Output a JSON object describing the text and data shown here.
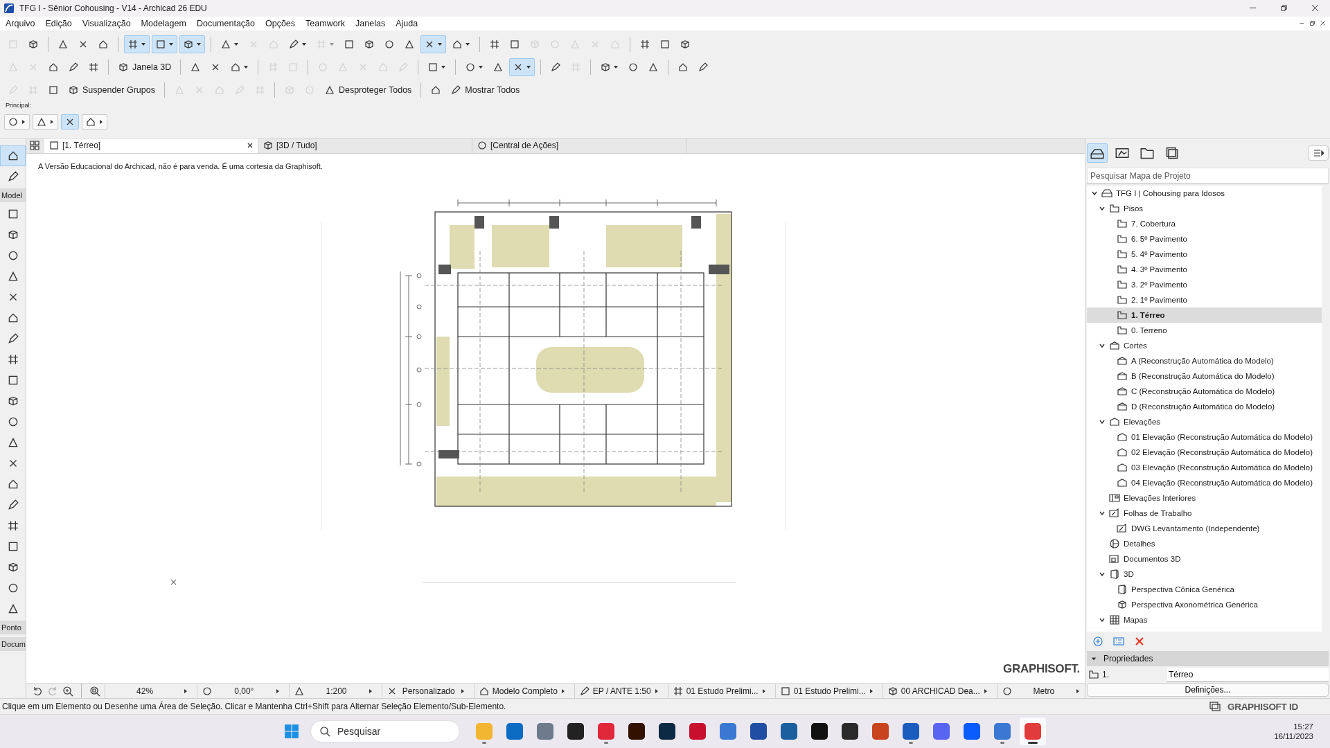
{
  "window": {
    "title": "TFG I - Sênior Cohousing - V14 - Archicad 26 EDU"
  },
  "menu": [
    "Arquivo",
    "Edição",
    "Visualização",
    "Modelagem",
    "Documentação",
    "Opções",
    "Teamwork",
    "Janelas",
    "Ajuda"
  ],
  "toolbars": [
    {
      "items": [
        {
          "kind": "icon",
          "dropdown": false,
          "pressed": false,
          "disabled": true
        },
        {
          "kind": "icon",
          "dropdown": false,
          "pressed": false,
          "disabled": false
        },
        {
          "kind": "separator"
        },
        {
          "kind": "icon",
          "dropdown": false,
          "pressed": false,
          "disabled": false
        },
        {
          "kind": "icon",
          "dropdown": false,
          "pressed": false,
          "disabled": false
        },
        {
          "kind": "icon",
          "dropdown": false,
          "pressed": false,
          "disabled": false
        },
        {
          "kind": "separator"
        },
        {
          "kind": "icon",
          "dropdown": true,
          "pressed": true,
          "disabled": false
        },
        {
          "kind": "icon",
          "dropdown": true,
          "pressed": true,
          "disabled": false
        },
        {
          "kind": "icon",
          "dropdown": true,
          "pressed": true,
          "disabled": false
        },
        {
          "kind": "separator"
        },
        {
          "kind": "icon",
          "dropdown": true,
          "pressed": false,
          "disabled": false
        },
        {
          "kind": "icon",
          "dropdown": false,
          "pressed": false,
          "disabled": true
        },
        {
          "kind": "icon",
          "dropdown": false,
          "pressed": false,
          "disabled": true
        },
        {
          "kind": "icon",
          "dropdown": true,
          "pressed": false,
          "disabled": false
        },
        {
          "kind": "icon",
          "dropdown": true,
          "pressed": false,
          "disabled": true
        },
        {
          "kind": "icon",
          "dropdown": false,
          "pressed": false,
          "disabled": false
        },
        {
          "kind": "icon",
          "dropdown": false,
          "pressed": false,
          "disabled": false
        },
        {
          "kind": "icon",
          "dropdown": false,
          "pressed": false,
          "disabled": false
        },
        {
          "kind": "icon",
          "dropdown": false,
          "pressed": false,
          "disabled": false
        },
        {
          "kind": "icon",
          "dropdown": true,
          "pressed": true,
          "disabled": false
        },
        {
          "kind": "icon",
          "dropdown": true,
          "pressed": false,
          "disabled": false
        },
        {
          "kind": "separator"
        },
        {
          "kind": "icon",
          "dropdown": false,
          "pressed": false,
          "disabled": false
        },
        {
          "kind": "icon",
          "dropdown": false,
          "pressed": false,
          "disabled": false
        },
        {
          "kind": "icon",
          "dropdown": false,
          "pressed": false,
          "disabled": true
        },
        {
          "kind": "icon",
          "dropdown": false,
          "pressed": false,
          "disabled": true
        },
        {
          "kind": "icon",
          "dropdown": false,
          "pressed": false,
          "disabled": true
        },
        {
          "kind": "icon",
          "dropdown": false,
          "pressed": false,
          "disabled": true
        },
        {
          "kind": "icon",
          "dropdown": false,
          "pressed": false,
          "disabled": true
        },
        {
          "kind": "separator"
        },
        {
          "kind": "icon",
          "dropdown": false,
          "pressed": false,
          "disabled": false
        },
        {
          "kind": "icon",
          "dropdown": false,
          "pressed": false,
          "disabled": false
        },
        {
          "kind": "icon",
          "dropdown": false,
          "pressed": false,
          "disabled": false
        }
      ]
    },
    {
      "items": [
        {
          "kind": "icon",
          "dropdown": false,
          "pressed": false,
          "disabled": true
        },
        {
          "kind": "icon",
          "dropdown": false,
          "pressed": false,
          "disabled": true
        },
        {
          "kind": "icon",
          "dropdown": false,
          "pressed": false,
          "disabled": false
        },
        {
          "kind": "icon",
          "dropdown": false,
          "pressed": false,
          "disabled": false
        },
        {
          "kind": "icon",
          "dropdown": false,
          "pressed": false,
          "disabled": false
        },
        {
          "kind": "separator"
        },
        {
          "kind": "label",
          "label": "Janela 3D",
          "disabled": false
        },
        {
          "kind": "separator"
        },
        {
          "kind": "icon",
          "dropdown": false,
          "pressed": false,
          "disabled": false
        },
        {
          "kind": "icon",
          "dropdown": false,
          "pressed": false,
          "disabled": false
        },
        {
          "kind": "icon",
          "dropdown": true,
          "pressed": false,
          "disabled": false
        },
        {
          "kind": "separator"
        },
        {
          "kind": "icon",
          "dropdown": false,
          "pressed": false,
          "disabled": true
        },
        {
          "kind": "icon",
          "dropdown": false,
          "pressed": false,
          "disabled": true
        },
        {
          "kind": "separator"
        },
        {
          "kind": "icon",
          "dropdown": false,
          "pressed": false,
          "disabled": true
        },
        {
          "kind": "icon",
          "dropdown": false,
          "pressed": false,
          "disabled": true
        },
        {
          "kind": "icon",
          "dropdown": false,
          "pressed": false,
          "disabled": true
        },
        {
          "kind": "icon",
          "dropdown": false,
          "pressed": false,
          "disabled": true
        },
        {
          "kind": "icon",
          "dropdown": false,
          "pressed": false,
          "disabled": true
        },
        {
          "kind": "separator"
        },
        {
          "kind": "icon",
          "dropdown": true,
          "pressed": false,
          "disabled": false
        },
        {
          "kind": "separator"
        },
        {
          "kind": "icon",
          "dropdown": true,
          "pressed": false,
          "disabled": false
        },
        {
          "kind": "icon",
          "dropdown": false,
          "pressed": false,
          "disabled": false
        },
        {
          "kind": "icon",
          "dropdown": true,
          "pressed": true,
          "disabled": false
        },
        {
          "kind": "separator"
        },
        {
          "kind": "icon",
          "dropdown": false,
          "pressed": false,
          "disabled": false
        },
        {
          "kind": "icon",
          "dropdown": false,
          "pressed": false,
          "disabled": true
        },
        {
          "kind": "separator"
        },
        {
          "kind": "icon",
          "dropdown": true,
          "pressed": false,
          "disabled": false
        },
        {
          "kind": "icon",
          "dropdown": false,
          "pressed": false,
          "disabled": false
        },
        {
          "kind": "icon",
          "dropdown": false,
          "pressed": false,
          "disabled": false
        },
        {
          "kind": "separator"
        },
        {
          "kind": "icon",
          "dropdown": false,
          "pressed": false,
          "disabled": false
        },
        {
          "kind": "icon",
          "dropdown": false,
          "pressed": false,
          "disabled": false
        }
      ]
    },
    {
      "items": [
        {
          "kind": "icon",
          "dropdown": false,
          "pressed": false,
          "disabled": true
        },
        {
          "kind": "icon",
          "dropdown": false,
          "pressed": false,
          "disabled": true
        },
        {
          "kind": "icon",
          "dropdown": false,
          "pressed": false,
          "disabled": false
        },
        {
          "kind": "label",
          "label": "Suspender Grupos",
          "disabled": false
        },
        {
          "kind": "separator"
        },
        {
          "kind": "icon",
          "dropdown": false,
          "pressed": false,
          "disabled": true
        },
        {
          "kind": "icon",
          "dropdown": false,
          "pressed": false,
          "disabled": true
        },
        {
          "kind": "icon",
          "dropdown": false,
          "pressed": false,
          "disabled": true
        },
        {
          "kind": "icon",
          "dropdown": false,
          "pressed": false,
          "disabled": true
        },
        {
          "kind": "icon",
          "dropdown": false,
          "pressed": false,
          "disabled": true
        },
        {
          "kind": "separator"
        },
        {
          "kind": "icon",
          "dropdown": false,
          "pressed": false,
          "disabled": true
        },
        {
          "kind": "icon",
          "dropdown": false,
          "pressed": false,
          "disabled": true
        },
        {
          "kind": "label",
          "label": "Desproteger Todos",
          "disabled": false
        },
        {
          "kind": "separator"
        },
        {
          "kind": "icon",
          "dropdown": false,
          "pressed": false,
          "disabled": false
        },
        {
          "kind": "label",
          "label": "Mostrar Todos",
          "disabled": false
        }
      ]
    }
  ],
  "principal": {
    "label": "Principal:",
    "items": [
      {
        "dropdown": true,
        "pressed": false
      },
      {
        "dropdown": true,
        "pressed": false
      },
      {
        "dropdown": false,
        "pressed": true
      },
      {
        "dropdown": true,
        "pressed": false
      }
    ]
  },
  "toolbox": [
    {
      "kind": "tool",
      "selected": true
    },
    {
      "kind": "tool",
      "selected": false
    },
    {
      "kind": "header",
      "label": "Model"
    },
    {
      "kind": "tool",
      "selected": false
    },
    {
      "kind": "tool",
      "selected": false
    },
    {
      "kind": "tool",
      "selected": false
    },
    {
      "kind": "tool",
      "selected": false
    },
    {
      "kind": "tool",
      "selected": false
    },
    {
      "kind": "tool",
      "selected": false
    },
    {
      "kind": "tool",
      "selected": false
    },
    {
      "kind": "tool",
      "selected": false
    },
    {
      "kind": "tool",
      "selected": false
    },
    {
      "kind": "tool",
      "selected": false
    },
    {
      "kind": "tool",
      "selected": false
    },
    {
      "kind": "tool",
      "selected": false
    },
    {
      "kind": "tool",
      "selected": false
    },
    {
      "kind": "tool",
      "selected": false
    },
    {
      "kind": "tool",
      "selected": false
    },
    {
      "kind": "tool",
      "selected": false
    },
    {
      "kind": "tool",
      "selected": false
    },
    {
      "kind": "tool",
      "selected": false
    },
    {
      "kind": "tool",
      "selected": false
    },
    {
      "kind": "tool",
      "selected": false
    },
    {
      "kind": "header",
      "label": "Ponto"
    },
    {
      "kind": "header",
      "label": "Docum"
    }
  ],
  "tabs": [
    {
      "label": "[1. Térreo]",
      "selected": true,
      "closable": true
    },
    {
      "label": "[3D / Tudo]",
      "selected": false,
      "closable": false
    },
    {
      "label": "[Central de Ações]",
      "selected": false,
      "closable": false
    }
  ],
  "canvas": {
    "notice": "A Versão Educacional do Archicad, não é para venda. É uma cortesia da Graphisoft.",
    "logo": "GRAPHISOFT."
  },
  "status_bar": [
    {
      "text": "42%"
    },
    {
      "text": "0,00°"
    },
    {
      "text": "1:200"
    },
    {
      "text": "Personalizado"
    },
    {
      "text": "Modelo Completo"
    },
    {
      "text": "EP / ANTE 1:50"
    },
    {
      "text": "01 Estudo Prelimi..."
    },
    {
      "text": "01 Estudo Prelimi..."
    },
    {
      "text": "00 ARCHICAD Dea..."
    },
    {
      "text": "Metro"
    }
  ],
  "message": "Clique em um Elemento ou Desenhe uma Área de Seleção. Clicar e Mantenha Ctrl+Shift para Alternar Seleção Elemento/Sub-Elemento.",
  "project_map": {
    "tabs": [
      {
        "selected": true
      },
      {
        "selected": false
      },
      {
        "selected": false
      },
      {
        "selected": false
      }
    ],
    "search": {
      "placeholder": "Pesquisar Mapa de Projeto"
    },
    "tree": [
      {
        "label": "TFG I | Cohousing para Idosos",
        "kind": "project",
        "expanded": true,
        "selected": false,
        "children": [
          {
            "label": "Pisos",
            "kind": "story",
            "expanded": true,
            "selected": false,
            "children": [
              {
                "label": "7. Cobertura",
                "kind": "story",
                "selected": false
              },
              {
                "label": "6. 5º Pavimento",
                "kind": "story",
                "selected": false
              },
              {
                "label": "5. 4º Pavimento",
                "kind": "story",
                "selected": false
              },
              {
                "label": "4. 3º Pavimento",
                "kind": "story",
                "selected": false
              },
              {
                "label": "3. 2º Pavimento",
                "kind": "story",
                "selected": false
              },
              {
                "label": "2. 1º Pavimento",
                "kind": "story",
                "selected": false
              },
              {
                "label": "1. Térreo",
                "kind": "story",
                "selected": true
              },
              {
                "label": "0. Terreno",
                "kind": "story",
                "selected": false
              }
            ]
          },
          {
            "label": "Cortes",
            "kind": "section",
            "expanded": true,
            "selected": false,
            "children": [
              {
                "label": "A (Reconstrução Automática do Modelo)",
                "kind": "section",
                "selected": false
              },
              {
                "label": "B (Reconstrução Automática do Modelo)",
                "kind": "section",
                "selected": false
              },
              {
                "label": "C (Reconstrução Automática do Modelo)",
                "kind": "section",
                "selected": false
              },
              {
                "label": "D (Reconstrução Automática do Modelo)",
                "kind": "section",
                "selected": false
              }
            ]
          },
          {
            "label": "Elevações",
            "kind": "elevation",
            "expanded": true,
            "selected": false,
            "children": [
              {
                "label": "01 Elevação (Reconstrução Automática do Modelo)",
                "kind": "elevation",
                "selected": false
              },
              {
                "label": "02 Elevação (Reconstrução Automática do Modelo)",
                "kind": "elevation",
                "selected": false
              },
              {
                "label": "03 Elevação (Reconstrução Automática do Modelo)",
                "kind": "elevation",
                "selected": false
              },
              {
                "label": "04 Elevação (Reconstrução Automática do Modelo)",
                "kind": "elevation",
                "selected": false
              }
            ]
          },
          {
            "label": "Elevações Interiores",
            "kind": "interior",
            "selected": false
          },
          {
            "label": "Folhas de Trabalho",
            "kind": "worksheet",
            "expanded": true,
            "selected": false,
            "children": [
              {
                "label": "DWG Levantamento (Independente)",
                "kind": "worksheet",
                "selected": false
              }
            ]
          },
          {
            "label": "Detalhes",
            "kind": "detail",
            "selected": false
          },
          {
            "label": "Documentos 3D",
            "kind": "doc3d",
            "selected": false
          },
          {
            "label": "3D",
            "kind": "view3d",
            "expanded": true,
            "selected": false,
            "children": [
              {
                "label": "Perspectiva Cônica Genérica",
                "kind": "view3d",
                "selected": false
              },
              {
                "label": "Perspectiva Axonométrica Genérica",
                "kind": "axo",
                "selected": false
              }
            ]
          },
          {
            "label": "Mapas",
            "kind": "map",
            "expanded": true,
            "selected": false
          }
        ]
      }
    ]
  },
  "properties": {
    "title": "Propriedades",
    "expanded": true,
    "number": "1.",
    "name": "Térreo",
    "button": "Definições..."
  },
  "account": "GRAPHISOFT ID",
  "taskbar": {
    "search": {
      "placeholder": "Pesquisar"
    },
    "apps": [
      {
        "color": "#f2b632",
        "running": true,
        "selected": false
      },
      {
        "color": "#0c6cc4",
        "running": false,
        "selected": false
      },
      {
        "color": "#6d7b8c",
        "running": false,
        "selected": false
      },
      {
        "color": "#222222",
        "running": false,
        "selected": false
      },
      {
        "color": "#e0283a",
        "running": true,
        "selected": false
      },
      {
        "color": "#331100",
        "running": false,
        "selected": false
      },
      {
        "color": "#0d2a45",
        "running": false,
        "selected": false
      },
      {
        "color": "#c8102e",
        "running": false,
        "selected": false
      },
      {
        "color": "#3a78d4",
        "running": false,
        "selected": false
      },
      {
        "color": "#1f4ea3",
        "running": false,
        "selected": false
      },
      {
        "color": "#1b5f9e",
        "running": false,
        "selected": false
      },
      {
        "color": "#111111",
        "running": false,
        "selected": false
      },
      {
        "color": "#2a2a2a",
        "running": false,
        "selected": false
      },
      {
        "color": "#c9431f",
        "running": false,
        "selected": false
      },
      {
        "color": "#1b5cbf",
        "running": true,
        "selected": false
      },
      {
        "color": "#5865f2",
        "running": false,
        "selected": false
      },
      {
        "color": "#0b5cff",
        "running": false,
        "selected": false
      },
      {
        "color": "#3a78d4",
        "running": true,
        "selected": false
      },
      {
        "color": "#e23b3b",
        "running": true,
        "selected": true
      }
    ],
    "time": "15:27",
    "date": "16/11/2023"
  }
}
